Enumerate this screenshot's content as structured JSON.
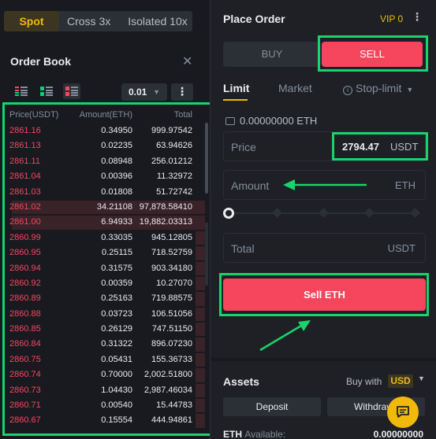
{
  "margin_tabs": {
    "spot": "Spot",
    "cross": "Cross 3x",
    "isolated": "Isolated 10x"
  },
  "order_book": {
    "title": "Order Book",
    "close_glyph": "✕",
    "tick_size": "0.01",
    "more_glyph": "⋮",
    "columns": {
      "price": "Price(USDT)",
      "amount": "Amount(ETH)",
      "total": "Total"
    },
    "rows": [
      {
        "price": "2861.16",
        "amount": "0.34950",
        "total": "999.97542",
        "depth": 0
      },
      {
        "price": "2861.13",
        "amount": "0.02235",
        "total": "63.94626",
        "depth": 0
      },
      {
        "price": "2861.11",
        "amount": "0.08948",
        "total": "256.01212",
        "depth": 0
      },
      {
        "price": "2861.04",
        "amount": "0.00396",
        "total": "11.32972",
        "depth": 0
      },
      {
        "price": "2861.03",
        "amount": "0.01808",
        "total": "51.72742",
        "depth": 0
      },
      {
        "price": "2861.02",
        "amount": "34.21108",
        "total": "97,878.58410",
        "depth": 1.0
      },
      {
        "price": "2861.00",
        "amount": "6.94933",
        "total": "19,882.03313",
        "depth": 1.0
      },
      {
        "price": "2860.99",
        "amount": "0.33035",
        "total": "945.12805",
        "depth": 0.05
      },
      {
        "price": "2860.95",
        "amount": "0.25115",
        "total": "718.52759",
        "depth": 0.05
      },
      {
        "price": "2860.94",
        "amount": "0.31575",
        "total": "903.34180",
        "depth": 0.05
      },
      {
        "price": "2860.92",
        "amount": "0.00359",
        "total": "10.27070",
        "depth": 0.05
      },
      {
        "price": "2860.89",
        "amount": "0.25163",
        "total": "719.88575",
        "depth": 0.05
      },
      {
        "price": "2860.88",
        "amount": "0.03723",
        "total": "106.51056",
        "depth": 0.05
      },
      {
        "price": "2860.85",
        "amount": "0.26129",
        "total": "747.51150",
        "depth": 0.05
      },
      {
        "price": "2860.84",
        "amount": "0.31322",
        "total": "896.07230",
        "depth": 0.05
      },
      {
        "price": "2860.75",
        "amount": "0.05431",
        "total": "155.36733",
        "depth": 0.05
      },
      {
        "price": "2860.74",
        "amount": "0.70000",
        "total": "2,002.51800",
        "depth": 0.05
      },
      {
        "price": "2860.73",
        "amount": "1.04430",
        "total": "2,987.46034",
        "depth": 0.05
      },
      {
        "price": "2860.71",
        "amount": "0.00540",
        "total": "15.44783",
        "depth": 0.05
      },
      {
        "price": "2860.67",
        "amount": "0.15554",
        "total": "444.94861",
        "depth": 0.05
      }
    ]
  },
  "place_order": {
    "title": "Place Order",
    "vip": "VIP 0",
    "menu_glyph": "⋮",
    "buy_label": "BUY",
    "sell_label": "SELL",
    "order_types": {
      "limit": "Limit",
      "market": "Market",
      "stop_limit": "Stop-limit"
    },
    "available": "0.00000000 ETH",
    "price": {
      "label": "Price",
      "value": "2794.47",
      "unit": "USDT"
    },
    "amount": {
      "label": "Amount",
      "unit": "ETH"
    },
    "total": {
      "label": "Total",
      "unit": "USDT"
    },
    "slider_level": 0,
    "submit_label": "Sell ETH"
  },
  "assets": {
    "title": "Assets",
    "buy_with_label": "Buy with",
    "currency": "USD",
    "deposit_label": "Deposit",
    "withdraw_label": "Withdraw",
    "eth_label": "ETH",
    "eth_sub": "Available:",
    "eth_value": "0.00000000"
  },
  "colors": {
    "sell": "#f6465d",
    "accent": "#f0b90b",
    "annotation": "#19d36b"
  }
}
